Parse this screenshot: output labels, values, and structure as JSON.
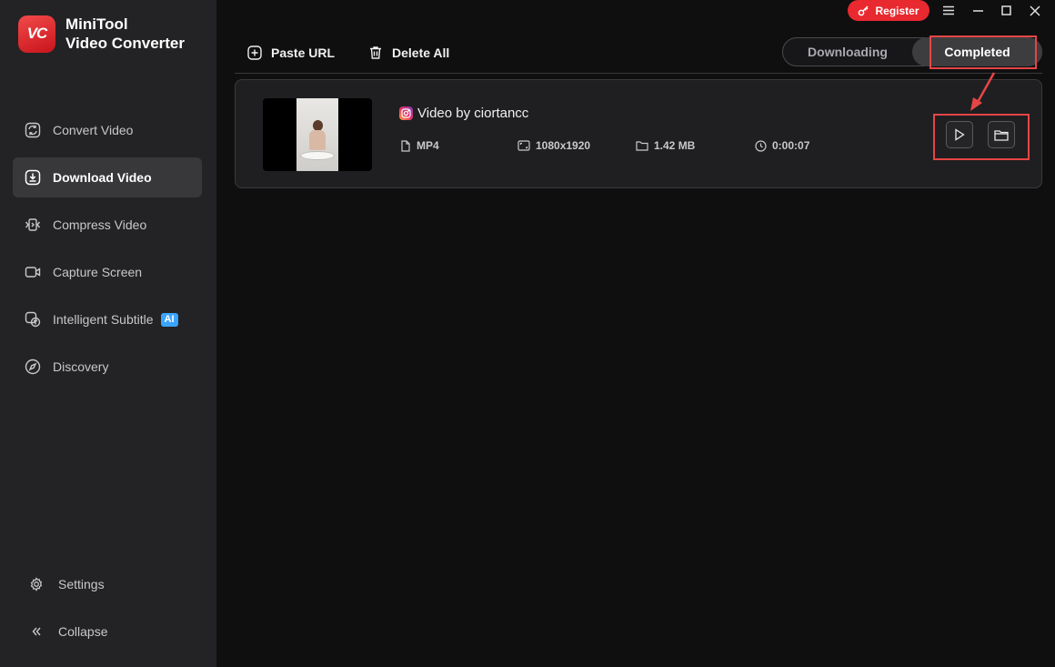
{
  "app": {
    "logo_badge": "VC",
    "name_line1": "MiniTool",
    "name_line2": "Video Converter"
  },
  "titlebar": {
    "register_label": "Register",
    "controls": [
      "menu-icon",
      "minimize-icon",
      "maximize-icon",
      "close-icon"
    ]
  },
  "sidebar": {
    "items": [
      {
        "label": "Convert Video",
        "icon": "convert-icon",
        "active": false
      },
      {
        "label": "Download Video",
        "icon": "download-icon",
        "active": true
      },
      {
        "label": "Compress Video",
        "icon": "compress-icon",
        "active": false
      },
      {
        "label": "Capture Screen",
        "icon": "camera-icon",
        "active": false
      },
      {
        "label": "Intelligent Subtitle",
        "icon": "subtitle-icon",
        "active": false,
        "badge": "AI"
      },
      {
        "label": "Discovery",
        "icon": "compass-icon",
        "active": false
      }
    ],
    "settings_label": "Settings",
    "collapse_label": "Collapse"
  },
  "toolbar": {
    "paste_url_label": "Paste URL",
    "delete_all_label": "Delete All"
  },
  "tabs": {
    "downloading_label": "Downloading",
    "completed_label": "Completed",
    "selected": "Completed"
  },
  "download": {
    "source_icon": "instagram-icon",
    "title": "Video by ciortancc",
    "format": "MP4",
    "resolution": "1080x1920",
    "size": "1.42 MB",
    "duration": "0:00:07"
  },
  "colors": {
    "accent_red": "#e8292f",
    "annotation_red": "#e64545",
    "ai_badge": "#3aa5ff"
  }
}
